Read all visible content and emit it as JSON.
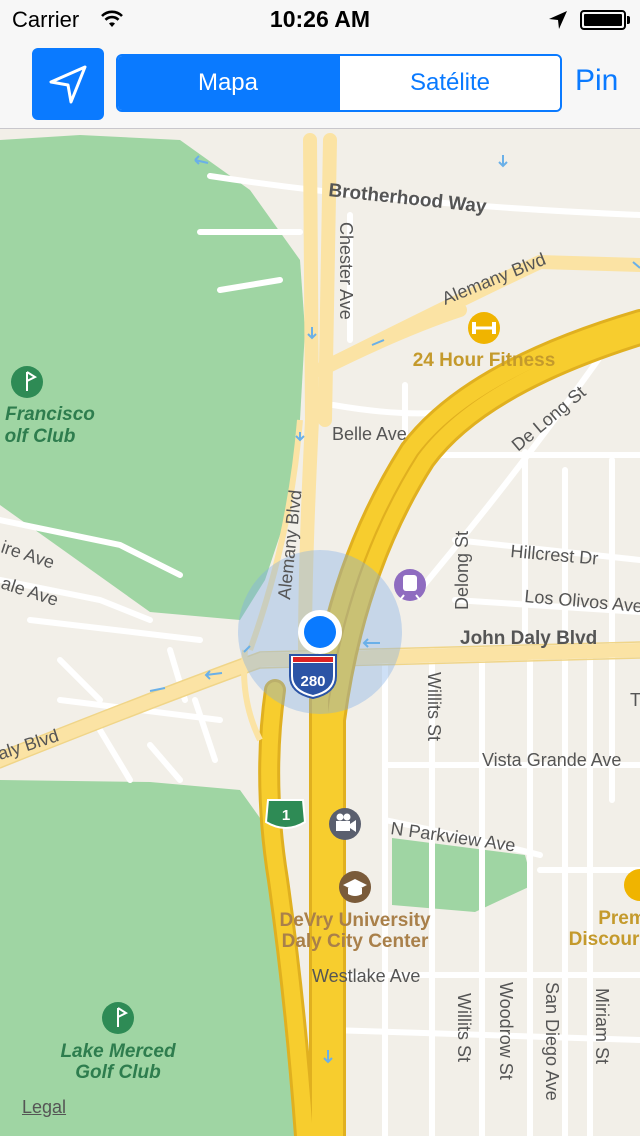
{
  "status_bar": {
    "carrier": "Carrier",
    "time": "10:26 AM"
  },
  "nav_bar": {
    "segments": [
      "Mapa",
      "Satélite"
    ],
    "selected_segment": "Mapa",
    "pin_label": "Pin"
  },
  "map": {
    "streets": {
      "brotherhood_way": "Brotherhood Way",
      "chester_ave": "Chester Ave",
      "alemany_blvd_top": "Alemany Blvd",
      "belle_ave": "Belle Ave",
      "de_long_st": "De Long St",
      "alemany_blvd_vertical": "Alemany Blvd",
      "delong_st": "Delong St",
      "hillcrest_dr": "Hillcrest Dr",
      "los_olivos_ave": "Los Olivos Ave",
      "john_daly_blvd": "John Daly Blvd",
      "ire_ave": "ire Ave",
      "ale_ave": "ale Ave",
      "aly_blvd": "aly Blvd",
      "willits_st": "Willits St",
      "vista_grande_ave": "Vista Grande Ave",
      "n_parkview_ave": "N Parkview Ave",
      "westlake_ave": "Westlake Ave",
      "willits_st_2": "Willits St",
      "woodrow_st": "Woodrow St",
      "san_diego_ave": "San Diego Ave",
      "miriam_st": "Miriam St",
      "edge_t": "T"
    },
    "pois": {
      "fitness": "24 Hour Fitness",
      "golf_top_line1": "Francisco",
      "golf_top_line2": "olf Club",
      "devry_line1": "DeVry University",
      "devry_line2": "Daly City Center",
      "lake_merced_line1": "Lake Merced",
      "lake_merced_line2": "Golf Club",
      "prem_line1": "Prem",
      "prem_line2": "Discour"
    },
    "shields": {
      "interstate": "280",
      "state_route": "1"
    },
    "legal": "Legal",
    "colors": {
      "park": "#9fd5a3",
      "land": "#f2efe8",
      "freeway": "#f7cd2e",
      "arterial": "#fbe3a4",
      "user_dot": "#0a7aff"
    }
  }
}
